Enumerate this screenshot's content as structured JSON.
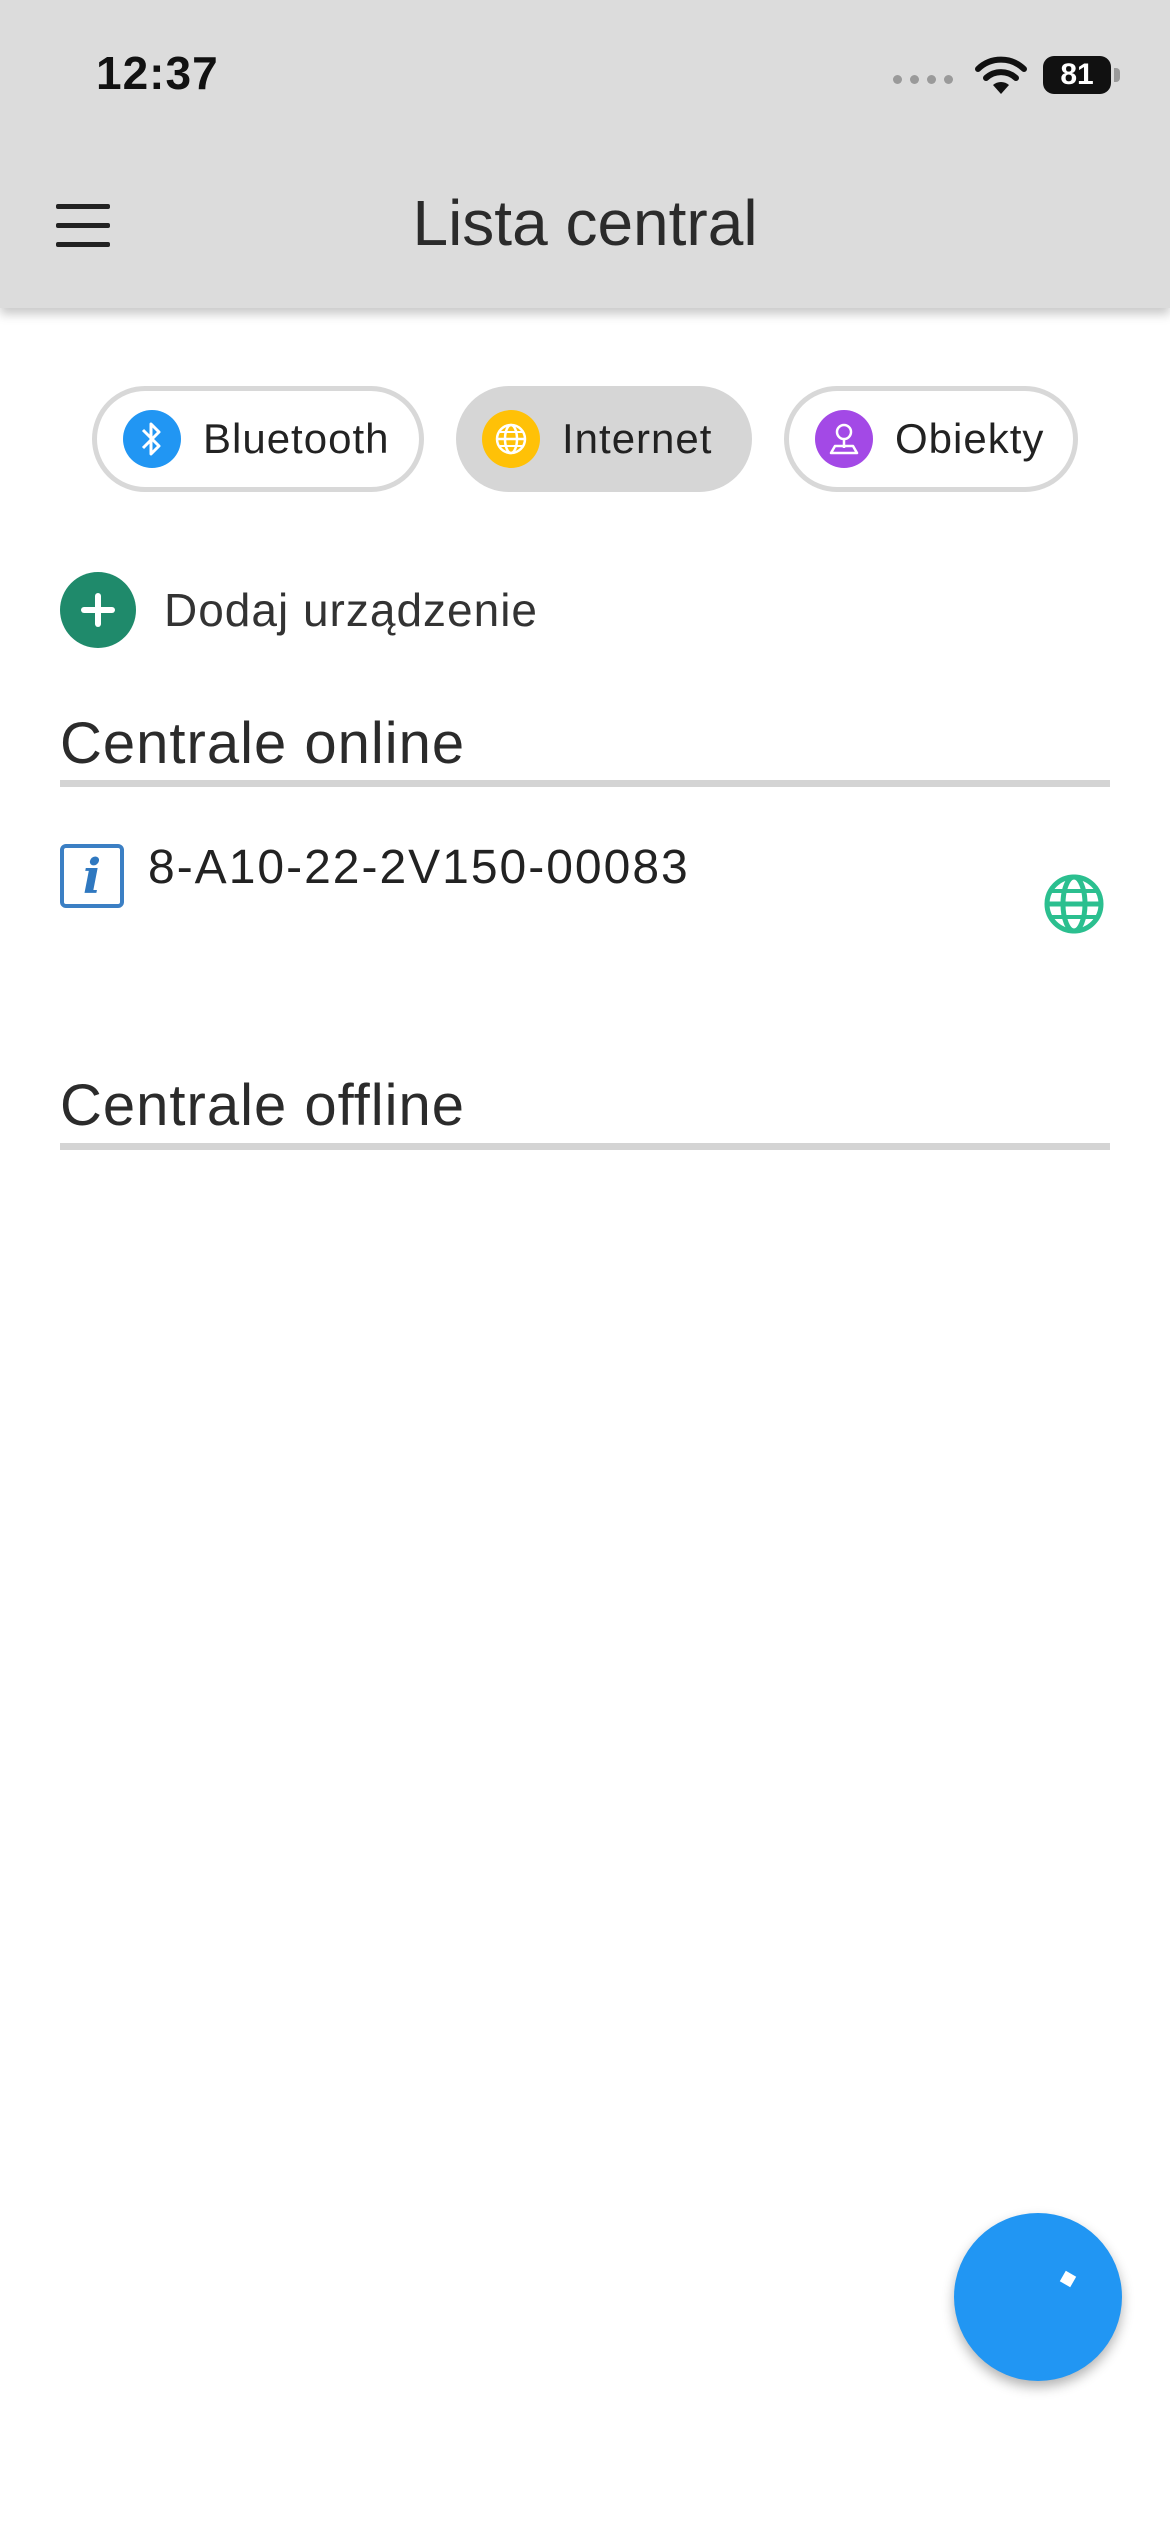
{
  "status_bar": {
    "time": "12:37",
    "battery": "81"
  },
  "header": {
    "title": "Lista central",
    "menu_icon": "hamburger-menu-icon"
  },
  "chips": [
    {
      "label": "Bluetooth",
      "icon": "bluetooth-icon",
      "color": "#2196f3",
      "selected": false
    },
    {
      "label": "Internet",
      "icon": "globe-icon",
      "color": "#ffc107",
      "selected": true
    },
    {
      "label": "Obiekty",
      "icon": "location-pin-icon",
      "color": "#a349e6",
      "selected": false
    }
  ],
  "add_device": {
    "label": "Dodaj urządzenie",
    "icon": "plus-icon",
    "color": "#1f8a6b"
  },
  "sections": {
    "online": {
      "title": "Centrale online"
    },
    "offline": {
      "title": "Centrale offline"
    }
  },
  "devices_online": [
    {
      "name": "8-A10-22-2V150-00083",
      "info_icon": "info-icon",
      "status_icon": "globe-icon",
      "status_color": "#2bbf8f"
    }
  ],
  "fab": {
    "icon": "loading-icon",
    "color": "#2196f3"
  }
}
